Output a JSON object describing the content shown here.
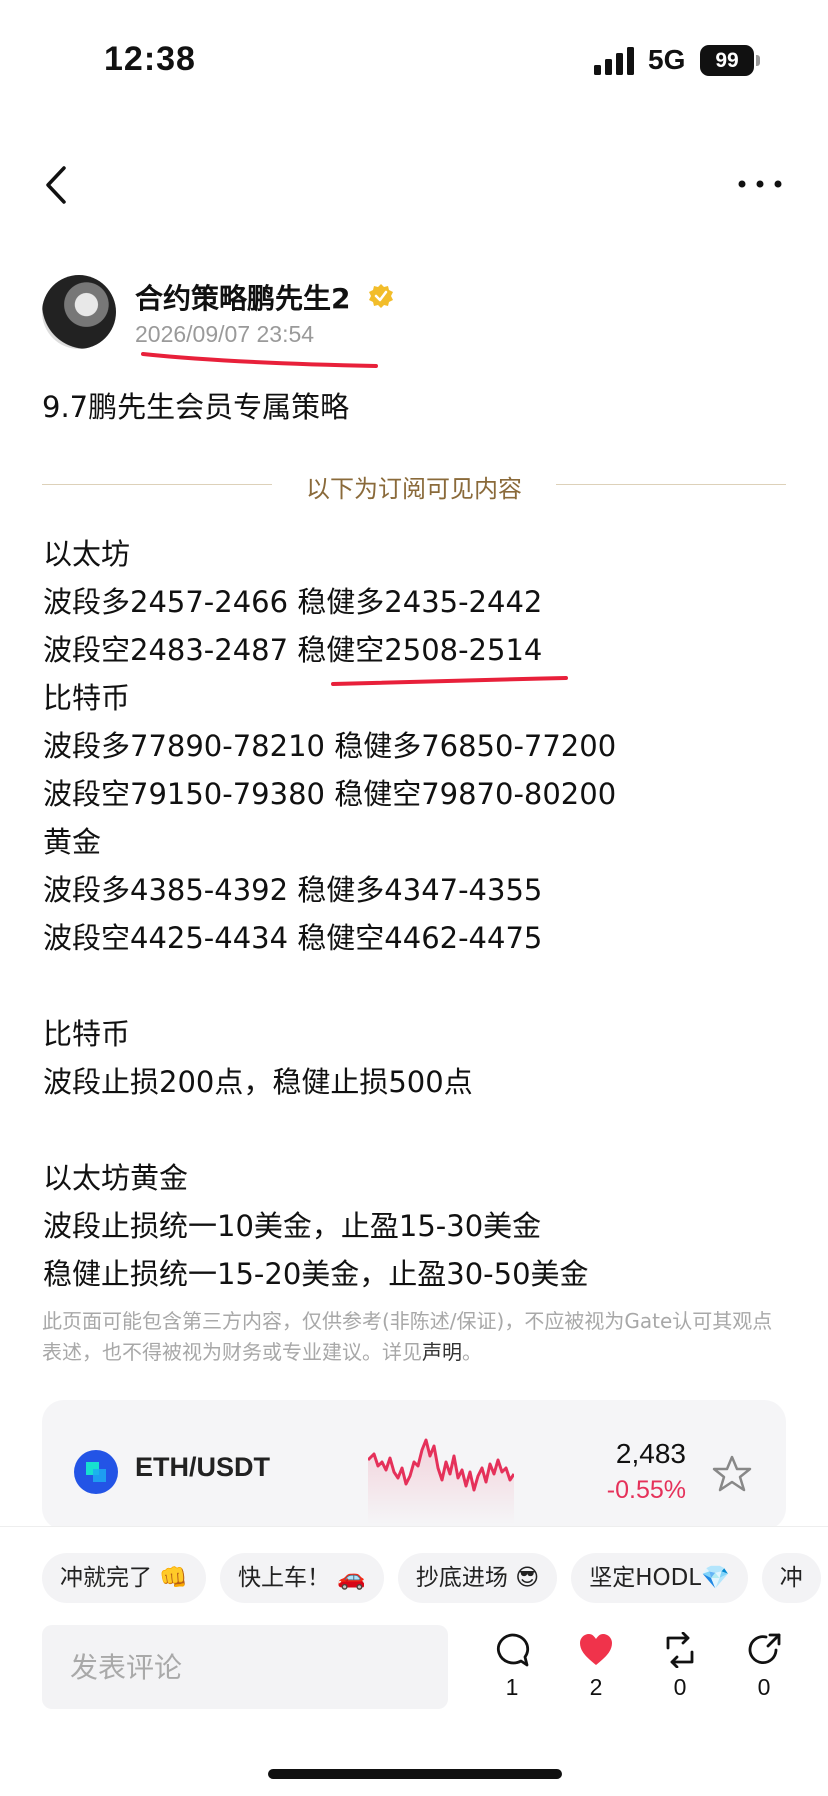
{
  "status_bar": {
    "time": "12:38",
    "network": "5G",
    "battery": "99"
  },
  "author": {
    "name": "合约策略鹏先生2",
    "time": "2026/09/07 23:54"
  },
  "post": {
    "title": "9.7鹏先生会员专属策略",
    "divider_label": "以下为订阅可见内容",
    "lines": [
      "以太坊",
      "波段多2457-2466 稳健多2435-2442",
      "波段空2483-2487 稳健空2508-2514",
      "比特币",
      "波段多77890-78210 稳健多76850-77200",
      "波段空79150-79380 稳健空79870-80200",
      "黄金",
      "波段多4385-4392 稳健多4347-4355",
      "波段空4425-4434 稳健空4462-4475",
      "",
      "比特币",
      "波段止损200点，稳健止损500点",
      "",
      "以太坊黄金",
      "波段止损统一10美金，止盈15-30美金",
      "稳健止损统一15-20美金，止盈30-50美金"
    ]
  },
  "disclaimer": {
    "text": "此页面可能包含第三方内容，仅供参考(非陈述/保证)，不应被视为Gate认可其观点表述，也不得被视为财务或专业建议。详见",
    "link": "声明",
    "end": "。"
  },
  "ticker": {
    "pair": "ETH/USDT",
    "price": "2,483",
    "change": "-0.55%",
    "change_color": "#e5315a"
  },
  "chips": [
    "冲就完了 👊",
    "快上车！ 🚗",
    "抄底进场 😎",
    "坚定HODL💎",
    "冲"
  ],
  "comment": {
    "placeholder": "发表评论"
  },
  "actions": {
    "comments": "1",
    "likes": "2",
    "reposts": "0",
    "shares": "0"
  },
  "colors": {
    "accent_red": "#e8203a",
    "divider_text": "#8a6a3a",
    "like_red": "#f0334b"
  }
}
